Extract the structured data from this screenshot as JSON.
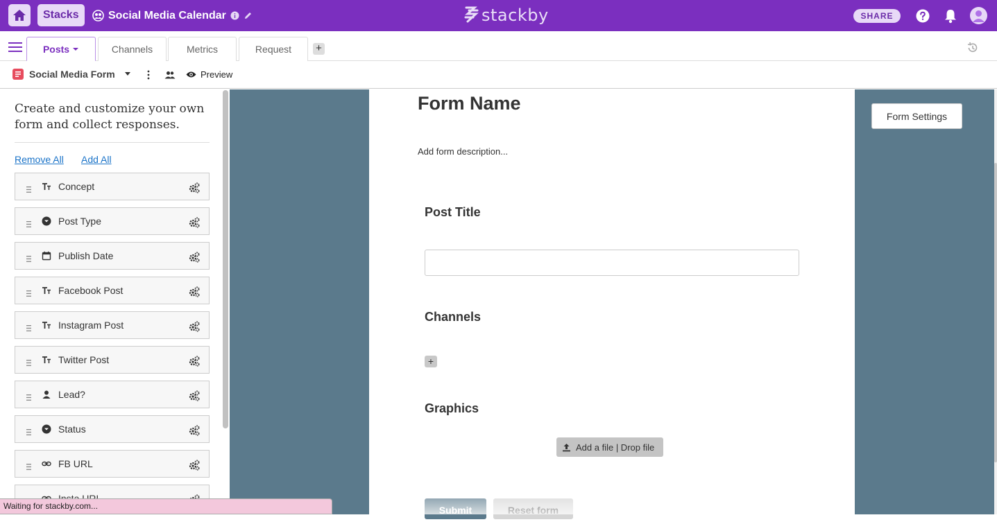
{
  "header": {
    "stacks_label": "Stacks",
    "stack_title": "Social Media Calendar",
    "logo_text": "stackby",
    "share_label": "SHARE",
    "brand_color": "#7b2fbf"
  },
  "tabs": [
    {
      "label": "Posts",
      "active": true
    },
    {
      "label": "Channels",
      "active": false
    },
    {
      "label": "Metrics",
      "active": false
    },
    {
      "label": "Request",
      "active": false
    }
  ],
  "add_tab_label": "+",
  "view": {
    "name": "Social Media Form",
    "preview_label": "Preview"
  },
  "sidebar": {
    "intro": "Create and customize your own form and collect responses.",
    "remove_all": "Remove All",
    "add_all": "Add All",
    "fields": [
      {
        "label": "Concept",
        "icon": "text-type-icon"
      },
      {
        "label": "Post Type",
        "icon": "single-select-icon"
      },
      {
        "label": "Publish Date",
        "icon": "calendar-icon"
      },
      {
        "label": "Facebook Post",
        "icon": "text-type-icon"
      },
      {
        "label": "Instagram Post",
        "icon": "text-type-icon"
      },
      {
        "label": "Twitter Post",
        "icon": "text-type-icon"
      },
      {
        "label": "Lead?",
        "icon": "person-icon"
      },
      {
        "label": "Status",
        "icon": "single-select-icon"
      },
      {
        "label": "FB URL",
        "icon": "link-icon"
      },
      {
        "label": "Insta URL",
        "icon": "link-icon"
      }
    ]
  },
  "form": {
    "name": "Form Name",
    "description": "Add form description...",
    "questions": [
      {
        "label": "Post Title",
        "type": "text"
      },
      {
        "label": "Channels",
        "type": "link"
      },
      {
        "label": "Graphics",
        "type": "attachment"
      }
    ],
    "add_link_label": "+",
    "upload_label": "Add a file | Drop file",
    "submit_label": "Submit",
    "reset_label": "Reset form",
    "settings_label": "Form Settings",
    "canvas_color": "#5b7a8c"
  },
  "status_bar": "Waiting for stackby.com..."
}
